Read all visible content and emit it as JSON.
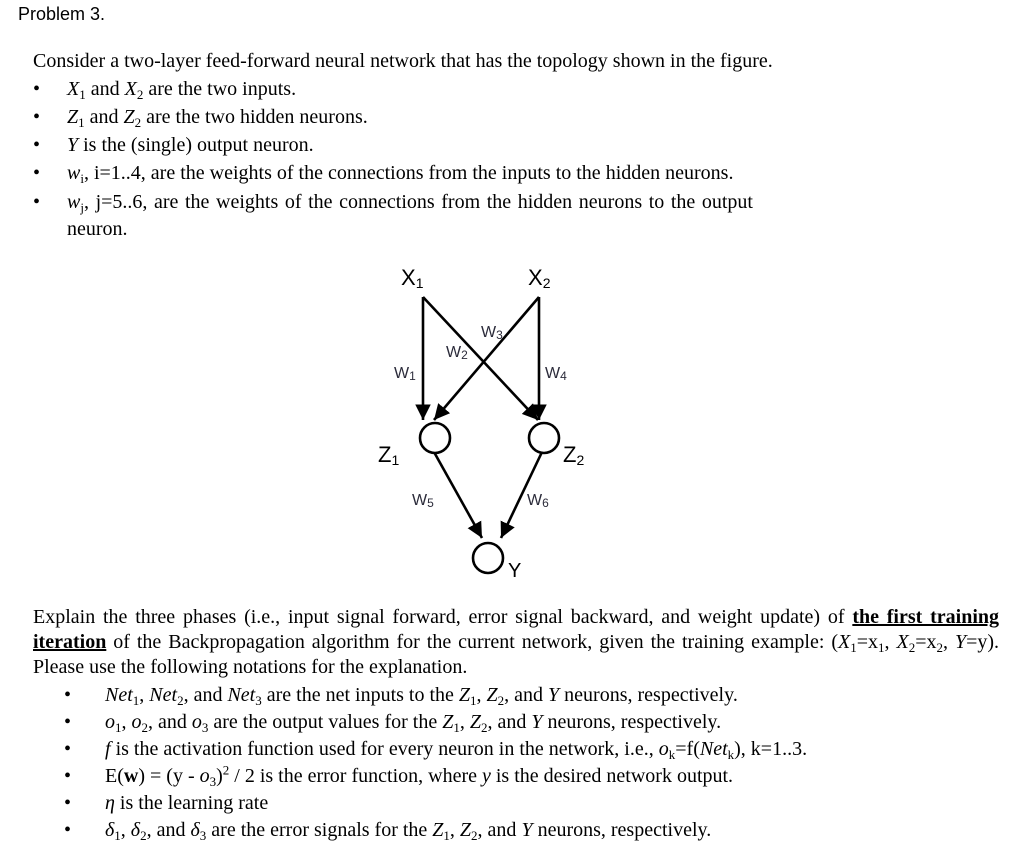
{
  "heading": "Problem 3.",
  "intro": "Consider a two-layer feed-forward neural network that has the topology shown in the figure.",
  "definitions": [
    {
      "sym": "X",
      "sub": "1",
      "mid": " and ",
      "sym2": "X",
      "sub2": "2",
      "rest": " are the two inputs."
    },
    {
      "sym": "Z",
      "sub": "1",
      "mid": " and ",
      "sym2": "Z",
      "sub2": "2",
      "rest": " are the two hidden neurons."
    },
    {
      "sym": "Y",
      "rest": " is the (single) output neuron."
    },
    {
      "sym": "w",
      "sub": "i",
      "rest": ", i=1..4, are the weights of the connections from the inputs to the hidden neurons."
    },
    {
      "sym": "w",
      "sub": "j",
      "rest": ", j=5..6, are the weights of the connections from the hidden neurons to the output neuron."
    }
  ],
  "diagram": {
    "nodes": {
      "x1": {
        "label": "X",
        "sub": "1"
      },
      "x2": {
        "label": "X",
        "sub": "2"
      },
      "z1": {
        "label": "Z",
        "sub": "1"
      },
      "z2": {
        "label": "Z",
        "sub": "2"
      },
      "y": {
        "label": "Y"
      }
    },
    "weights": {
      "w1": {
        "label": "W",
        "sub": "1"
      },
      "w2": {
        "label": "W",
        "sub": "2"
      },
      "w3": {
        "label": "W",
        "sub": "3"
      },
      "w4": {
        "label": "W",
        "sub": "4"
      },
      "w5": {
        "label": "W",
        "sub": "5"
      },
      "w6": {
        "label": "W",
        "sub": "6"
      }
    }
  },
  "explain": {
    "part1": "Explain the three phases (i.e., input signal forward, error signal backward, and weight update) of ",
    "bold": "the first training iteration",
    "part2": " of the Backpropagation algorithm for the current network, given the training example: (",
    "ex_x1": "X",
    "ex_x1_sub": "1",
    "ex_x1_val": "=x",
    "ex_x1_val_sub": "1",
    "ex_x2": "X",
    "ex_x2_sub": "2",
    "ex_x2_val": "=x",
    "ex_x2_val_sub": "2",
    "ex_y": "Y",
    "ex_y_val": "=y",
    "part3": "). Please use the following notations for the explanation."
  },
  "notations": [
    "Net1, Net2, and Net3 are the net inputs to the Z1, Z2, and Y neurons, respectively.",
    "o1, o2, and o3 are the output values for the Z1, Z2, and Y neurons, respectively.",
    "f is the activation function used for every neuron in the network, i.e., ok=f(Netk), k=1..3.",
    "E(w) = (y - o3)^2 / 2 is the error function, where y is the desired network output.",
    "η is the learning rate",
    "δ1, δ2, and δ3 are the error signals for the Z1, Z2, and Y neurons, respectively."
  ],
  "bullet": "•"
}
